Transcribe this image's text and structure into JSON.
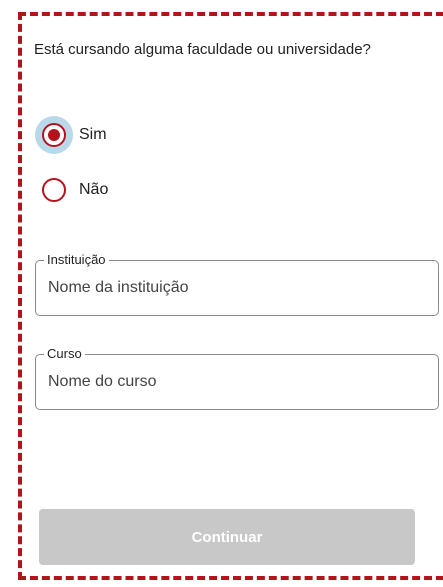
{
  "question": "Está cursando alguma faculdade ou universidade?",
  "options": [
    {
      "label": "Sim",
      "selected": true
    },
    {
      "label": "Não",
      "selected": false
    }
  ],
  "fields": {
    "institution": {
      "label": "Instituição",
      "placeholder": "Nome da instituição",
      "value": ""
    },
    "course": {
      "label": "Curso",
      "placeholder": "Nome do curso",
      "value": ""
    }
  },
  "button": {
    "label": "Continuar",
    "enabled": false
  },
  "colors": {
    "accent": "#b3131b",
    "focus_halo": "#b9d8ea",
    "button_disabled": "#c8c8c8"
  }
}
